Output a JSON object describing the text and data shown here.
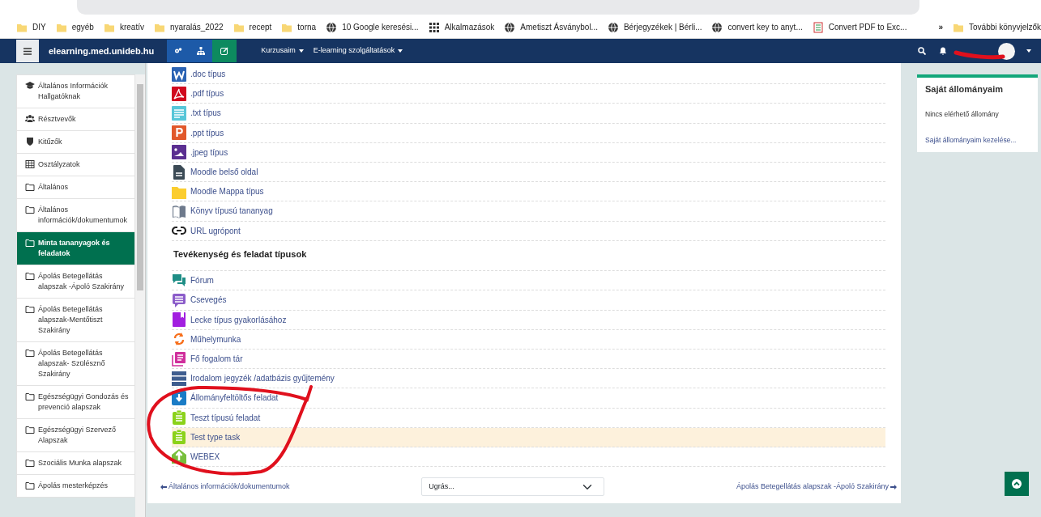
{
  "browser": {
    "bookmarks": [
      {
        "kind": "folder",
        "label": "DIY"
      },
      {
        "kind": "folder",
        "label": "egyéb"
      },
      {
        "kind": "folder",
        "label": "kreatív"
      },
      {
        "kind": "folder",
        "label": "nyaralás_2022"
      },
      {
        "kind": "folder",
        "label": "recept"
      },
      {
        "kind": "folder",
        "label": "torna"
      },
      {
        "kind": "globe",
        "label": "10 Google keresési..."
      },
      {
        "kind": "apps",
        "label": "Alkalmazások"
      },
      {
        "kind": "globe",
        "label": "Ametiszt Ásványbol..."
      },
      {
        "kind": "globe",
        "label": "Bérjegyzékek | Bérli..."
      },
      {
        "kind": "globe",
        "label": "convert key to anyt..."
      },
      {
        "kind": "pdf",
        "label": "Convert PDF to Exc..."
      }
    ],
    "more": "»",
    "other_bookmarks": "További könyvjelzők"
  },
  "navbar": {
    "site_name": "elearning.med.unideb.hu",
    "menus": [
      "Kurzusaim",
      "E-learning szolgáltatások"
    ]
  },
  "sidebar": {
    "items": [
      {
        "kind": "cap",
        "label": "Általános Információk Hallgatóknak",
        "selected": false
      },
      {
        "kind": "users",
        "label": "Résztvevők",
        "selected": false
      },
      {
        "kind": "shield",
        "label": "Kitűzők",
        "selected": false
      },
      {
        "kind": "table",
        "label": "Osztályzatok",
        "selected": false
      },
      {
        "kind": "folder",
        "label": "Általános",
        "selected": false
      },
      {
        "kind": "folder",
        "label": "Általános információk/dokumentumok",
        "selected": false
      },
      {
        "kind": "folder",
        "label": "Minta tananyagok és feladatok",
        "selected": true
      },
      {
        "kind": "folder",
        "label": "Ápolás Betegellátás alapszak -Ápoló Szakirány",
        "selected": false
      },
      {
        "kind": "folder",
        "label": "Ápolás Betegellátás alapszak-Mentőtiszt Szakirány",
        "selected": false
      },
      {
        "kind": "folder",
        "label": "Ápolás Betegellátás alapszak- Szülésznő Szakirány",
        "selected": false
      },
      {
        "kind": "folder",
        "label": "Egészségügyi Gondozás és prevenció alapszak",
        "selected": false
      },
      {
        "kind": "folder",
        "label": "Egészségügyi Szervező Alapszak",
        "selected": false
      },
      {
        "kind": "folder",
        "label": "Szociális Munka alapszak",
        "selected": false
      },
      {
        "kind": "folder",
        "label": "Ápolás mesterképzés",
        "selected": false
      }
    ]
  },
  "main": {
    "sections": [
      {
        "items": [
          {
            "kind": "word",
            "label": ".doc típus",
            "highlighted": false
          },
          {
            "kind": "pdf",
            "label": ".pdf típus",
            "highlighted": false
          },
          {
            "kind": "txt",
            "label": ".txt típus",
            "highlighted": false
          },
          {
            "kind": "ppt",
            "label": ".ppt típus",
            "highlighted": false
          },
          {
            "kind": "image",
            "label": ".jpeg típus",
            "highlighted": false
          },
          {
            "kind": "page",
            "label": "Moodle belső oldal",
            "highlighted": false
          },
          {
            "kind": "folder",
            "label": "Moodle Mappa típus",
            "highlighted": false
          },
          {
            "kind": "book",
            "label": "Könyv típusú tananyag",
            "highlighted": false
          },
          {
            "kind": "url",
            "label": "URL ugrópont",
            "highlighted": false
          }
        ]
      },
      {
        "heading": "Tevékenység és feladat típusok",
        "items": [
          {
            "kind": "forum",
            "label": "Fórum",
            "highlighted": false
          },
          {
            "kind": "chat",
            "label": "Csevegés",
            "highlighted": false
          },
          {
            "kind": "lesson",
            "label": "Lecke típus gyakorlásához",
            "highlighted": false
          },
          {
            "kind": "workshop",
            "label": "Műhelymunka",
            "highlighted": false
          },
          {
            "kind": "glossary",
            "label": "Fő fogalom tár",
            "highlighted": false
          },
          {
            "kind": "database",
            "label": "Irodalom jegyzék /adatbázis gyűjtemény",
            "highlighted": false
          },
          {
            "kind": "upload",
            "label": "Állományfeltöltős feladat",
            "highlighted": false
          },
          {
            "kind": "quiz",
            "label": "Teszt típusú feladat",
            "highlighted": false
          },
          {
            "kind": "quiz",
            "label": "Test type task",
            "highlighted": true
          },
          {
            "kind": "webex",
            "label": "WEBEX",
            "highlighted": false
          }
        ]
      }
    ],
    "previous": "Általános információk/dokumentumok",
    "jump_menu": {
      "value": "Ugrás..."
    },
    "next": "Ápolás Betegellátás alapszak -Ápoló Szakirány"
  },
  "block": {
    "title": "Saját állományaim",
    "empty": "Nincs elérhető állomány",
    "link": "Saját állományaim kezelése..."
  }
}
